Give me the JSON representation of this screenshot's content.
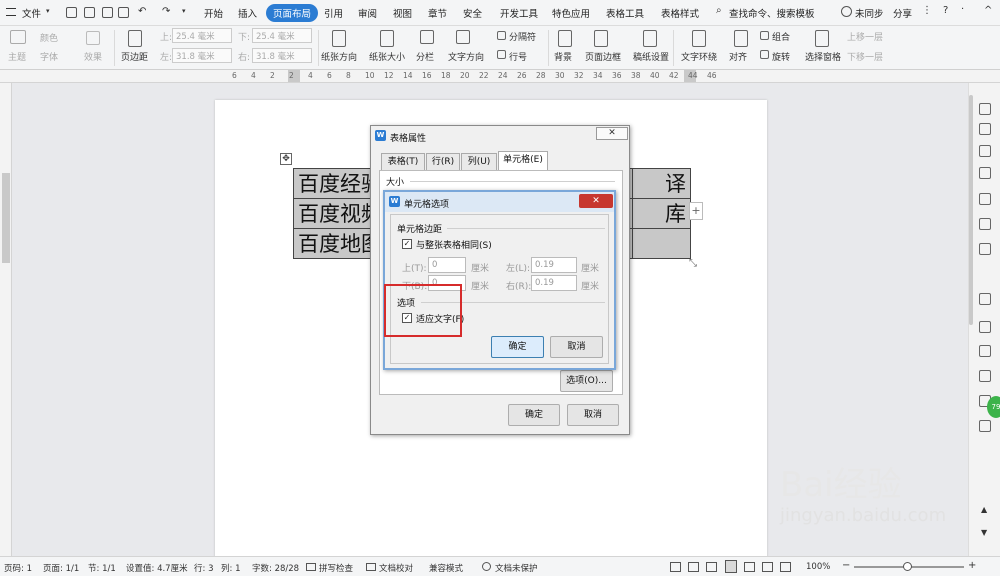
{
  "menubar": {
    "file": "文件",
    "tabs": [
      "开始",
      "插入",
      "页面布局",
      "引用",
      "审阅",
      "视图",
      "章节",
      "安全",
      "开发工具",
      "特色应用",
      "表格工具",
      "表格样式"
    ],
    "active_tab": "页面布局",
    "search": "查找命令、搜索模板",
    "sync": "未同步",
    "share": "分享"
  },
  "ribbon": {
    "theme": "主题",
    "color": "颜色",
    "font": "字体",
    "effect": "效果",
    "margins": "页边距",
    "top_label": "上:",
    "top_value": "25.4 毫米",
    "bottom_label": "下:",
    "bottom_value": "25.4 毫米",
    "left_label": "左:",
    "left_value": "31.8 毫米",
    "right_label": "右:",
    "right_value": "31.8 毫米",
    "orientation": "纸张方向",
    "size": "纸张大小",
    "columns": "分栏",
    "text_direction": "文字方向",
    "separator": "分隔符",
    "line_number": "行号",
    "background": "背景",
    "page_border": "页面边框",
    "draft_setup": "稿纸设置",
    "wrap": "文字环绕",
    "align": "对齐",
    "group": "组合",
    "rotate": "旋转",
    "selection_pane": "选择窗格",
    "bring_forward": "上移一层",
    "send_backward": "下移一层"
  },
  "ruler_numbers": [
    "6",
    "4",
    "2",
    "2",
    "4",
    "6",
    "8",
    "10",
    "12",
    "14",
    "16",
    "18",
    "20",
    "22",
    "24",
    "26",
    "28",
    "30",
    "32",
    "34",
    "36",
    "38",
    "40",
    "42",
    "44",
    "46"
  ],
  "document": {
    "rows": [
      {
        "left": "百度经验",
        "right": "译"
      },
      {
        "left": "百度视频",
        "right": "库"
      },
      {
        "left": "百度地图",
        "right": ""
      }
    ]
  },
  "table_props": {
    "title": "表格属性",
    "tabs": [
      "表格(T)",
      "行(R)",
      "列(U)",
      "单元格(E)"
    ],
    "active_tab": "单元格(E)",
    "size_label": "大小",
    "options_button": "选项(O)...",
    "ok": "确定",
    "cancel": "取消"
  },
  "cell_options": {
    "title": "单元格选项",
    "margins_section": "单元格边距",
    "same_as_table": "与整张表格相同(S)",
    "same_as_table_checked": true,
    "top_label": "上(T):",
    "top_value": "0",
    "left_label": "左(L):",
    "left_value": "0.19",
    "bottom_label": "下(B):",
    "bottom_value": "0",
    "right_label": "右(R):",
    "right_value": "0.19",
    "unit": "厘米",
    "options_section": "选项",
    "fit_text": "适应文字(F)",
    "fit_text_checked": true,
    "ok": "确定",
    "cancel": "取消"
  },
  "statusbar": {
    "page_num": "页码: 1",
    "page": "页面: 1/1",
    "section": "节: 1/1",
    "setting": "设置值: 4.7厘米",
    "row": "行: 3",
    "col": "列: 1",
    "words": "字数: 28/28",
    "spell": "拼写检查",
    "proof": "文档校对",
    "compat": "兼容模式",
    "protect": "文档未保护",
    "zoom": "100%"
  },
  "side_badge": "79",
  "watermark": {
    "text": "Bai经验",
    "url": "jingyan.baidu.com"
  },
  "colors": {
    "accent": "#2b7cd3",
    "highlight_box": "#d62b2b",
    "cell_fill": "#c8c8c8"
  }
}
